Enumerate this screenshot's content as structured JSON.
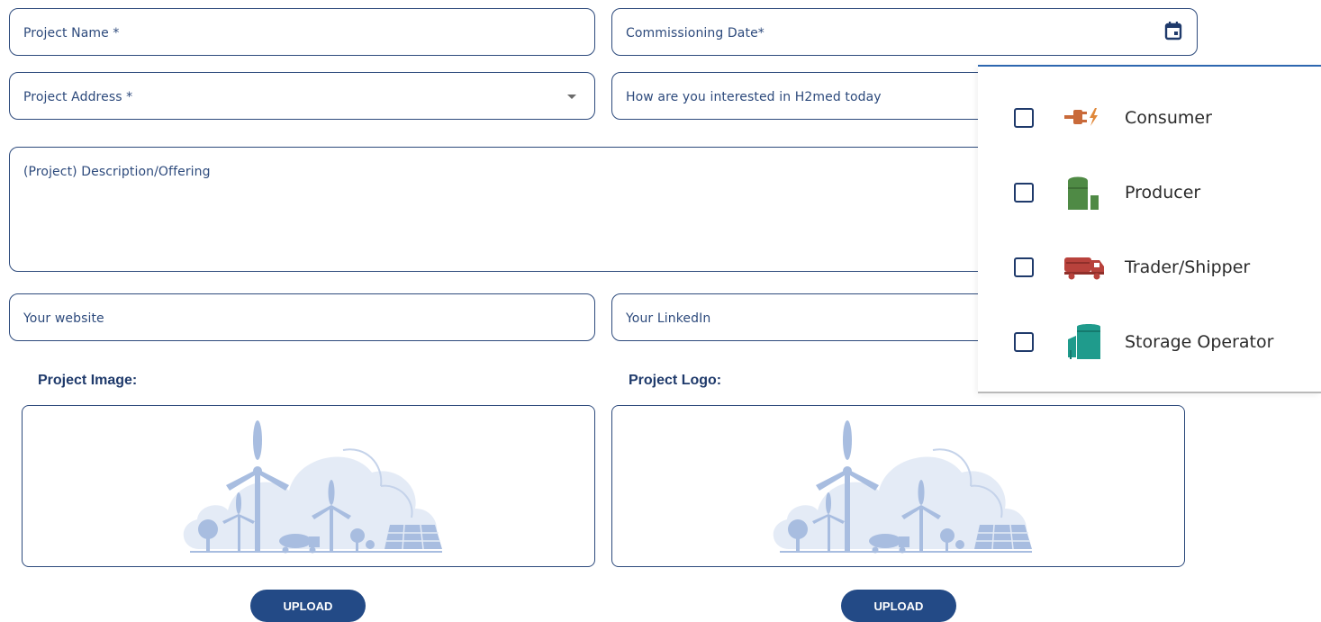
{
  "form": {
    "project_name": "Project Name *",
    "commissioning_date": "Commissioning Date*",
    "project_address": "Project Address *",
    "interest_prompt": "How are you interested in H2med today",
    "description": "(Project) Description/Offering",
    "website": "Your website",
    "linkedin": "Your LinkedIn"
  },
  "uploads": {
    "image_title": "Project Image:",
    "logo_title": "Project Logo:",
    "upload_label": "UPLOAD"
  },
  "interest_options": [
    {
      "label": "Consumer",
      "icon": "plug-lightning-icon",
      "color": "#c96a3a",
      "checked": false
    },
    {
      "label": "Producer",
      "icon": "producer-tank-icon",
      "color": "#4f8a45",
      "checked": false
    },
    {
      "label": "Trader/Shipper",
      "icon": "truck-icon",
      "color": "#b8423c",
      "checked": false
    },
    {
      "label": "Storage Operator",
      "icon": "storage-tank-icon",
      "color": "#1f9b8c",
      "checked": false
    }
  ],
  "colors": {
    "border": "#2d4a7c",
    "button": "#234a86",
    "illustration": "#a8bde0"
  }
}
